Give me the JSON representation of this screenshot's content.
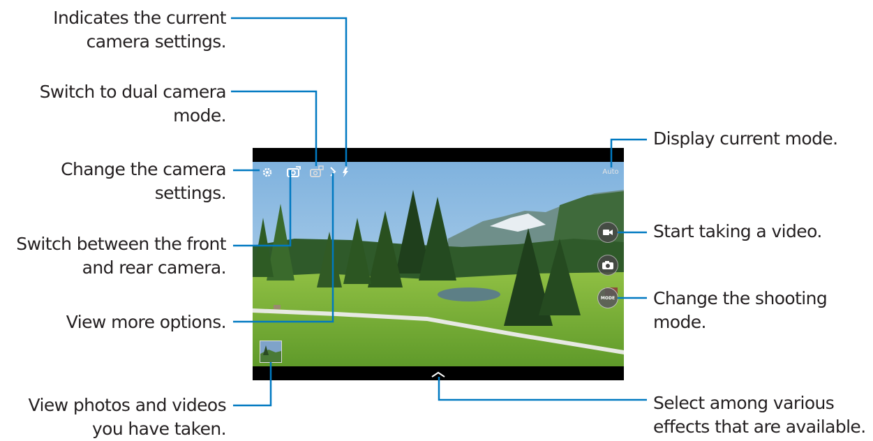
{
  "callouts": {
    "settings_indicator": [
      "Indicates the current",
      "camera settings."
    ],
    "dual_camera": [
      "Switch to dual camera",
      "mode."
    ],
    "change_settings": [
      "Change the camera",
      "settings."
    ],
    "switch_camera": [
      "Switch between the front",
      "and rear camera."
    ],
    "more_options": [
      "View more options."
    ],
    "gallery": [
      "View photos and videos",
      "you have taken."
    ],
    "current_mode": [
      "Display current mode."
    ],
    "video": [
      "Start taking a video."
    ],
    "shooting_mode": [
      "Change the shooting",
      "mode."
    ],
    "effects": [
      "Select among various",
      "effects that are available."
    ]
  },
  "screen": {
    "mode_label": "Auto",
    "mode_button_label": "MODE",
    "icons": {
      "settings": "gear-icon",
      "switch_camera": "camera-switch-icon",
      "dual_camera": "dual-camera-icon",
      "more": "chevron-right-icon",
      "flash": "flash-auto-icon",
      "video": "video-camera-icon",
      "shutter": "camera-icon",
      "effects": "chevron-up-icon",
      "gallery": "thumbnail-icon"
    }
  },
  "colors": {
    "leader_line": "#0079c1",
    "text": "#231f20",
    "bezel": "#000000"
  }
}
